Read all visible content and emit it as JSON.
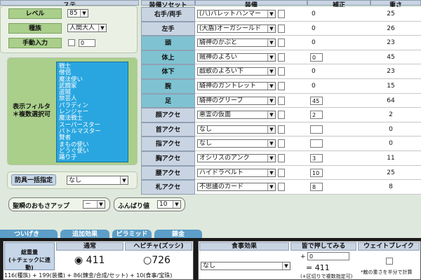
{
  "left": {
    "header": "ステ",
    "level_label": "レベル",
    "level_value": "85",
    "race_label": "種族",
    "race_value": "人間大人",
    "manual_label": "手動入力",
    "manual_value": "0",
    "filter_label": "表示フィルタ",
    "filter_note": "＊複数選択可",
    "jobs": [
      "戦士",
      "僧侶",
      "魔法使い",
      "武闘家",
      "盗賊",
      "旅芸人",
      "パラディン",
      "レンジャー",
      "魔法戦士",
      "スーパースター",
      "バトルマスター",
      "賢者",
      "まもの使い",
      "どうぐ使い",
      "踊り子"
    ],
    "party_label": "防具一括指定",
    "party_value": "なし",
    "intimidation_label": "聖瞬のおもさアップ",
    "intimidation_value": "－",
    "funbari_label": "ふんばり値",
    "funbari_value": "10"
  },
  "table": {
    "headers": [
      "装備ソセット",
      "装備",
      "補正",
      "重さ"
    ],
    "rows": [
      {
        "slot": "右手/両手",
        "item": "(八)バレットハンマー",
        "fixed": "0",
        "weight": "25",
        "style": "plain"
      },
      {
        "slot": "左手",
        "item": "(大盾)オーガシールド",
        "fixed": "0",
        "weight": "26",
        "style": "plain"
      },
      {
        "slot": "頭",
        "item": "騎神のかぶと",
        "fixed": "0",
        "weight": "23",
        "style": "teal"
      },
      {
        "slot": "体上",
        "item": "賊神のよろい",
        "fixed": "0",
        "weight": "45",
        "style": "teal",
        "box": "0"
      },
      {
        "slot": "体下",
        "item": "戯歌のよろい下",
        "fixed": "0",
        "weight": "23",
        "style": "teal"
      },
      {
        "slot": "腕",
        "item": "騎神のガントレット",
        "fixed": "0",
        "weight": "15",
        "style": "teal"
      },
      {
        "slot": "足",
        "item": "騎神のグリーブ",
        "fixed": "",
        "weight": "64",
        "style": "teal",
        "box": "45"
      },
      {
        "slot": "顔アクセ",
        "item": "悪霊の仮面",
        "fixed": "",
        "weight": "2",
        "style": "plain",
        "box": "2"
      },
      {
        "slot": "首アクセ",
        "item": "なし",
        "fixed": "",
        "weight": "0",
        "style": "plain",
        "box": ""
      },
      {
        "slot": "指アクセ",
        "item": "なし",
        "fixed": "",
        "weight": "0",
        "style": "plain",
        "box": ""
      },
      {
        "slot": "胸アクセ",
        "item": "オシリスのアンク",
        "fixed": "",
        "weight": "11",
        "style": "plain",
        "box": "3"
      },
      {
        "slot": "腰アクセ",
        "item": "ハイドラベルト",
        "fixed": "",
        "weight": "25",
        "style": "plain",
        "box": "10"
      },
      {
        "slot": "札アクセ",
        "item": "不思議のカード",
        "fixed": "",
        "weight": "8",
        "style": "plain",
        "box": "8"
      }
    ]
  },
  "tabs": [
    "ついげき",
    "追加効果",
    "ピラミッド",
    "錬金"
  ],
  "weight": {
    "total_label": "総重量",
    "total_note": "(＋チェックに連動)",
    "normal_label": "通常",
    "normal_value": "411",
    "hephaestus_label": "ヘピチャ(ズッシ)",
    "hephaestus_value": "726",
    "formula": "116(種族) + 199(装備) + 86(錬金/合成/セット) + 10(食事/宝珠)"
  },
  "meal": {
    "effect_label": "食事効果",
    "effect_value": "なし",
    "hold_label": "皆で押してみる",
    "break_label": "ウェイトブレイク",
    "plus": "+",
    "hold_input": "0",
    "hold_result": "= 411",
    "hold_note": "(+区切りで複数指定可)",
    "break_note": "*敵の重さを半分で計算"
  }
}
